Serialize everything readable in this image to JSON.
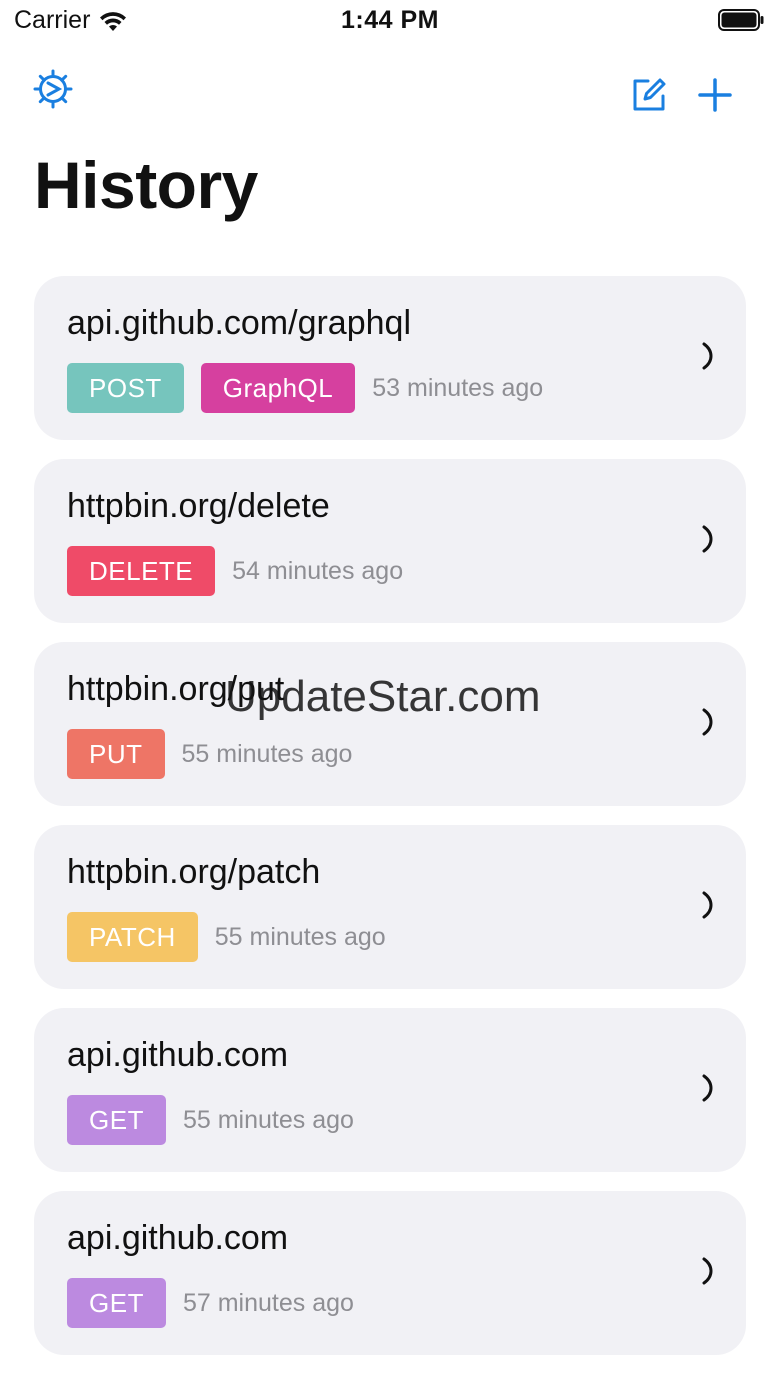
{
  "status_bar": {
    "carrier": "Carrier",
    "time": "1:44 PM"
  },
  "nav": {
    "settings_icon": "gear-icon",
    "compose_icon": "compose-icon",
    "add_icon": "plus-icon",
    "accent": "#1a7fe0"
  },
  "title": "History",
  "history": [
    {
      "url": "api.github.com/graphql",
      "badges": [
        {
          "label": "POST",
          "color": "#76c5bd"
        },
        {
          "label": "GraphQL",
          "color": "#d6409f"
        }
      ],
      "time": "53 minutes ago"
    },
    {
      "url": "httpbin.org/delete",
      "badges": [
        {
          "label": "DELETE",
          "color": "#ef4b68"
        }
      ],
      "time": "54 minutes ago"
    },
    {
      "url": "httpbin.org/put",
      "badges": [
        {
          "label": "PUT",
          "color": "#ee7566"
        }
      ],
      "time": "55 minutes ago"
    },
    {
      "url": "httpbin.org/patch",
      "badges": [
        {
          "label": "PATCH",
          "color": "#f5c565"
        }
      ],
      "time": "55 minutes ago"
    },
    {
      "url": "api.github.com",
      "badges": [
        {
          "label": "GET",
          "color": "#bc8ae0"
        }
      ],
      "time": "55 minutes ago"
    },
    {
      "url": "api.github.com",
      "badges": [
        {
          "label": "GET",
          "color": "#bc8ae0"
        }
      ],
      "time": "57 minutes ago"
    }
  ],
  "watermark": "UpdateStar.com"
}
